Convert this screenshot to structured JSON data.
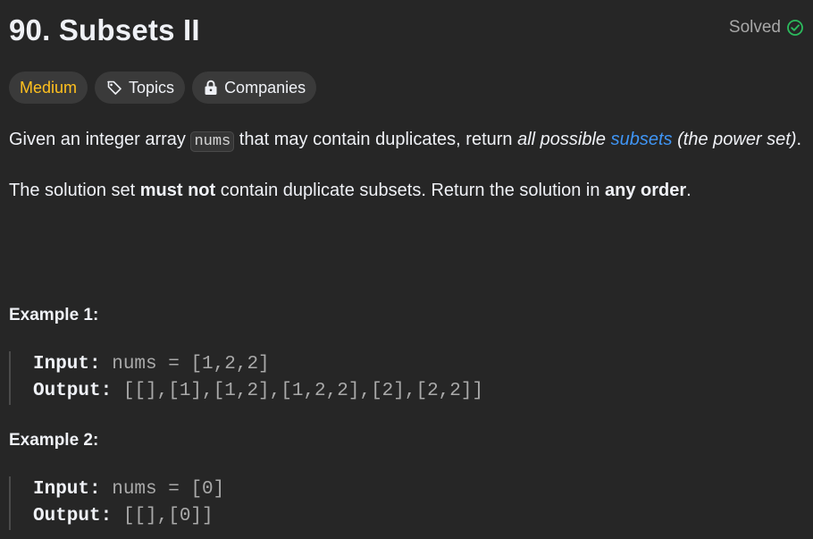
{
  "header": {
    "title": "90. Subsets II",
    "status_label": "Solved",
    "status_color": "#2cbb5d",
    "status_icon": "check-circle-icon"
  },
  "tags": {
    "difficulty": "Medium",
    "difficulty_color": "#ffc01e",
    "topics": "Topics",
    "topics_icon": "tag-icon",
    "companies": "Companies",
    "companies_icon": "lock-icon"
  },
  "description": {
    "p1": {
      "t1": "Given an integer array ",
      "code": "nums",
      "t2": " that may contain duplicates, return ",
      "em1": "all possible ",
      "link": "subsets",
      "em2": " (the power set)",
      "t3": "."
    },
    "p2": {
      "t1": "The solution set ",
      "b1": "must not",
      "t2": " contain duplicate subsets. Return the solution in ",
      "b2": "any order",
      "t3": "."
    }
  },
  "examples": [
    {
      "title": "Example 1:",
      "input_label": "Input:",
      "input_value": " nums = [1,2,2]",
      "output_label": "Output:",
      "output_value": " [[],[1],[1,2],[1,2,2],[2],[2,2]]"
    },
    {
      "title": "Example 2:",
      "input_label": "Input:",
      "input_value": " nums = [0]",
      "output_label": "Output:",
      "output_value": " [[],[0]]"
    }
  ]
}
